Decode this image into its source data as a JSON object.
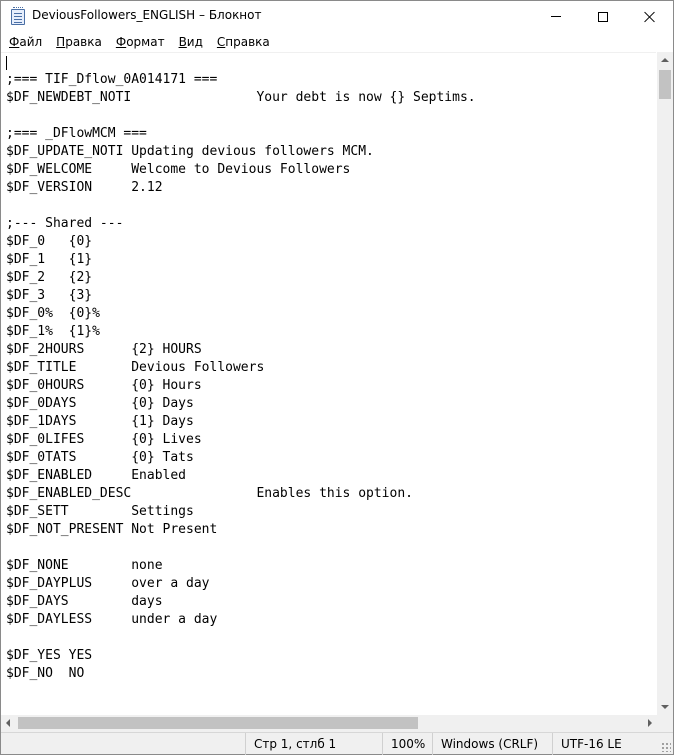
{
  "window": {
    "title": "DeviousFollowers_ENGLISH – Блокнот",
    "icon": "notepad-icon"
  },
  "menu": [
    "Файл",
    "Правка",
    "Формат",
    "Вид",
    "Справка"
  ],
  "editor": {
    "lines": [
      ";=== TIF_Dflow_0A014171 ===",
      "$DF_NEWDEBT_NOTI\t\tYour debt is now {} Septims.",
      "",
      ";=== _DFlowMCM ===",
      "$DF_UPDATE_NOTI\tUpdating devious followers MCM.",
      "$DF_WELCOME\tWelcome to Devious Followers",
      "$DF_VERSION\t2.12",
      "",
      ";--- Shared ---",
      "$DF_0\t{0}",
      "$DF_1\t{1}",
      "$DF_2\t{2}",
      "$DF_3\t{3}",
      "$DF_0%\t{0}%",
      "$DF_1%\t{1}%",
      "$DF_2HOURS\t{2} HOURS",
      "$DF_TITLE\tDevious Followers",
      "$DF_0HOURS\t{0} Hours",
      "$DF_0DAYS\t{0} Days",
      "$DF_1DAYS\t{1} Days",
      "$DF_0LIFES\t{0} Lives",
      "$DF_0TATS\t{0} Tats",
      "$DF_ENABLED\tEnabled",
      "$DF_ENABLED_DESC\t\tEnables this option.",
      "$DF_SETT\tSettings",
      "$DF_NOT_PRESENT\tNot Present",
      "",
      "$DF_NONE\tnone",
      "$DF_DAYPLUS\tover a day",
      "$DF_DAYS\tdays",
      "$DF_DAYLESS\tunder a day",
      "",
      "$DF_YES\tYES",
      "$DF_NO\tNO"
    ]
  },
  "status": {
    "position": "Стр 1, стлб 1",
    "zoom": "100%",
    "line_endings": "Windows (CRLF)",
    "encoding": "UTF-16 LE"
  }
}
